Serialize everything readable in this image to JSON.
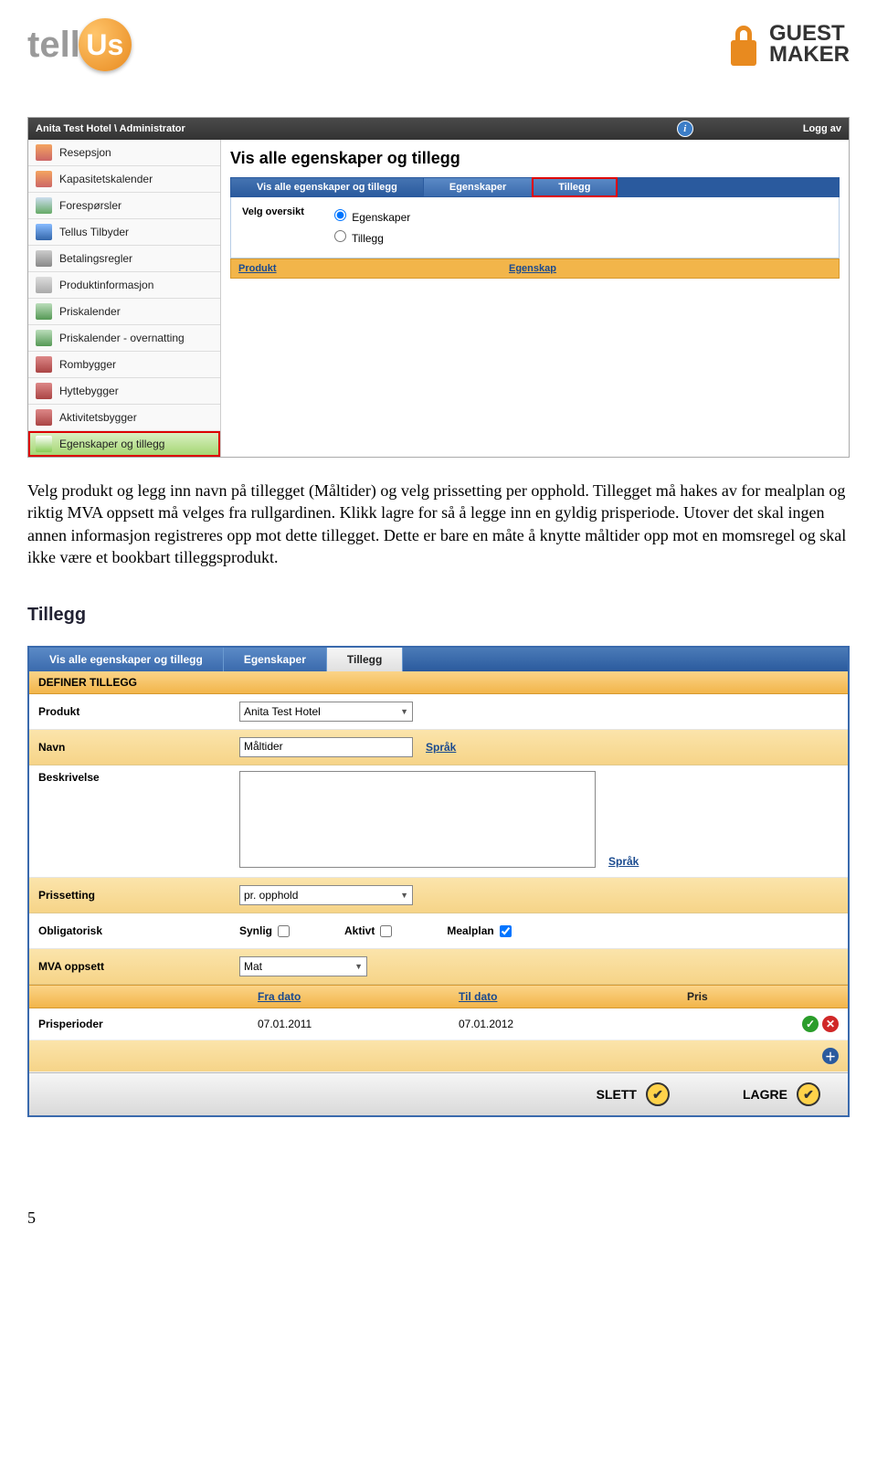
{
  "header": {
    "logo_tell": "tell",
    "logo_us": "Us",
    "gm_line1": "GUEST",
    "gm_line2": "MAKER"
  },
  "app": {
    "breadcrumb": "Anita Test Hotel \\ Administrator",
    "logoff": "Logg av",
    "sidebar": {
      "items": [
        "Resepsjon",
        "Kapasitetskalender",
        "Forespørsler",
        "Tellus Tilbyder",
        "Betalingsregler",
        "Produktinformasjon",
        "Priskalender",
        "Priskalender - overnatting",
        "Rombygger",
        "Hyttebygger",
        "Aktivitetsbygger",
        "Egenskaper og tillegg"
      ]
    },
    "content_title": "Vis alle egenskaper og tillegg",
    "tabs": [
      "Vis alle egenskaper og tillegg",
      "Egenskaper",
      "Tillegg"
    ],
    "panel": {
      "velg_label": "Velg oversikt",
      "radio1": "Egenskaper",
      "radio2": "Tillegg"
    },
    "table": {
      "col1": "Produkt",
      "col2": "Egenskap"
    }
  },
  "body_text": "Velg produkt og legg inn navn på tillegget (Måltider) og velg prissetting per opphold. Tillegget må hakes av for mealplan og riktig MVA oppsett må velges fra rullgardinen. Klikk lagre for så å legge inn en gyldig prisperiode. Utover det skal ingen annen informasjon registreres opp mot dette tillegget. Dette er bare en måte å knytte måltider opp mot en momsregel og skal ikke være et bookbart tilleggsprodukt.",
  "tillegg": {
    "title": "Tillegg",
    "tabs": [
      "Vis alle egenskaper og tillegg",
      "Egenskaper",
      "Tillegg"
    ],
    "section": "DEFINER TILLEGG",
    "fields": {
      "produkt_label": "Produkt",
      "produkt_value": "Anita Test Hotel",
      "navn_label": "Navn",
      "navn_value": "Måltider",
      "sprak": "Språk",
      "beskrivelse_label": "Beskrivelse",
      "prissetting_label": "Prissetting",
      "prissetting_value": "pr. opphold",
      "obligatorisk_label": "Obligatorisk",
      "synlig": "Synlig",
      "aktivt": "Aktivt",
      "mealplan": "Mealplan",
      "mva_label": "MVA oppsett",
      "mva_value": "Mat",
      "prisperioder_label": "Prisperioder"
    },
    "price_header": {
      "fra": "Fra dato",
      "til": "Til dato",
      "pris": "Pris"
    },
    "price_row": {
      "fra": "07.01.2011",
      "til": "07.01.2012"
    },
    "buttons": {
      "slett": "SLETT",
      "lagre": "LAGRE"
    }
  },
  "page_number": "5"
}
